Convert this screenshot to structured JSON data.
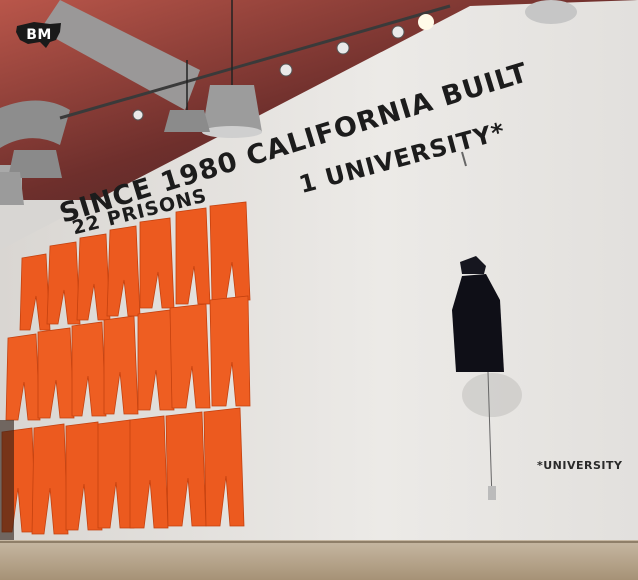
{
  "logo": {
    "text": "BM"
  },
  "wall": {
    "headline": "SINCE 1980 CALIFORNIA BUILT",
    "line_prisons": "22 PRISONS",
    "line_university": "1 UNIVERSITY*",
    "footnote": "*UNIVERSITY"
  },
  "colors": {
    "jumpsuit": "#ec5a1f",
    "wall": "#e6e4e1",
    "gown": "#0f0f17",
    "ceiling": "#7c3530"
  }
}
